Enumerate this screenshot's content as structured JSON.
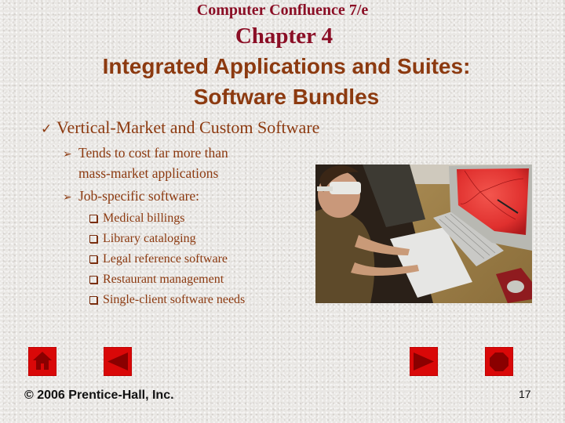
{
  "header": {
    "course_title": "Computer Confluence 7/e",
    "chapter_title": "Chapter 4",
    "slide_title_line1": "Integrated Applications and Suites:",
    "slide_title_line2": "Software Bundles"
  },
  "content": {
    "main_bullet": {
      "icon": "check-mark-icon",
      "glyph": "✓",
      "text": "Vertical-Market and Custom Software"
    },
    "sub_bullets": [
      {
        "icon": "arrowhead-icon",
        "glyph": "➢",
        "text_line1": "Tends to cost far more than",
        "text_line2": "mass-market applications"
      },
      {
        "icon": "arrowhead-icon",
        "glyph": "➢",
        "text_line1": "Job-specific software:"
      }
    ],
    "examples": [
      "Medical billings",
      "Library cataloging",
      "Legal reference software",
      "Restaurant management",
      "Single-client software needs"
    ]
  },
  "photo": {
    "description": "Person wearing 3D glasses working at a computer displaying a retina image, with keyboard, drawing tablet and mouse"
  },
  "navigation": {
    "buttons": [
      {
        "name": "home",
        "icon": "home-icon"
      },
      {
        "name": "back",
        "icon": "triangle-left-icon"
      },
      {
        "name": "forward",
        "icon": "triangle-right-icon"
      },
      {
        "name": "end",
        "icon": "octagon-stop-icon"
      }
    ],
    "button_color": "#d90808",
    "glyph_color": "#8a0000"
  },
  "footer": {
    "copyright": "© 2006 Prentice-Hall, Inc.",
    "page_number": "17"
  }
}
